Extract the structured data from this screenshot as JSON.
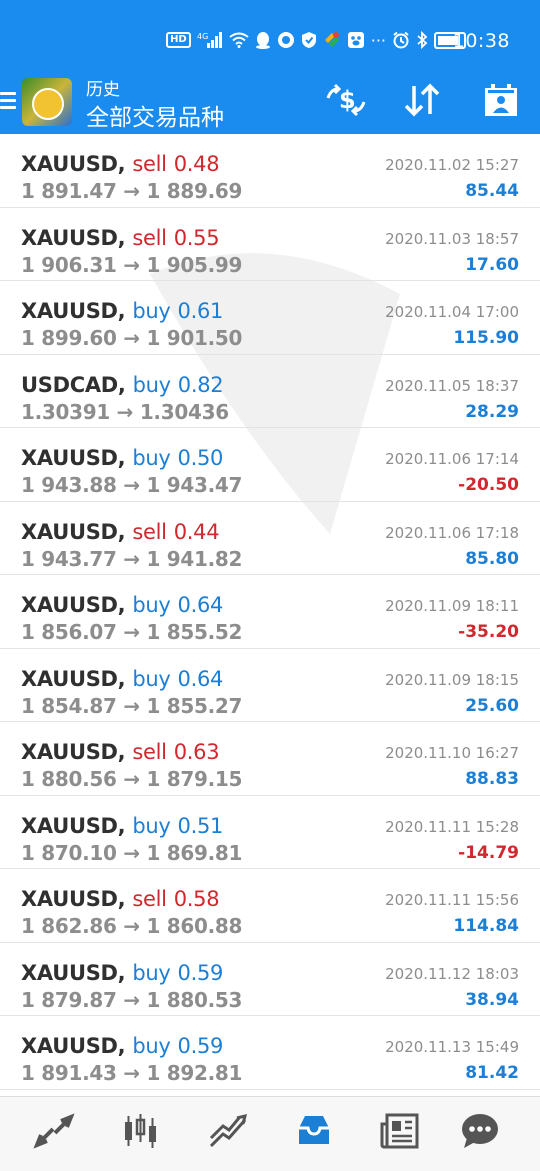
{
  "status_bar": {
    "hd": "HD",
    "network": "4G",
    "time": "10:38"
  },
  "header": {
    "subtitle": "历史",
    "title": "全部交易品种",
    "accent_color": "#1a8cf0"
  },
  "trades": [
    {
      "symbol": "XAUUSD,",
      "side": "sell",
      "volume": "0.48",
      "open": "1 891.47",
      "close": "1 889.69",
      "date": "2020.11.02 15:27",
      "profit": "85.44"
    },
    {
      "symbol": "XAUUSD,",
      "side": "sell",
      "volume": "0.55",
      "open": "1 906.31",
      "close": "1 905.99",
      "date": "2020.11.03 18:57",
      "profit": "17.60"
    },
    {
      "symbol": "XAUUSD,",
      "side": "buy",
      "volume": "0.61",
      "open": "1 899.60",
      "close": "1 901.50",
      "date": "2020.11.04 17:00",
      "profit": "115.90"
    },
    {
      "symbol": "USDCAD,",
      "side": "buy",
      "volume": "0.82",
      "open": "1.30391",
      "close": "1.30436",
      "date": "2020.11.05 18:37",
      "profit": "28.29"
    },
    {
      "symbol": "XAUUSD,",
      "side": "buy",
      "volume": "0.50",
      "open": "1 943.88",
      "close": "1 943.47",
      "date": "2020.11.06 17:14",
      "profit": "-20.50"
    },
    {
      "symbol": "XAUUSD,",
      "side": "sell",
      "volume": "0.44",
      "open": "1 943.77",
      "close": "1 941.82",
      "date": "2020.11.06 17:18",
      "profit": "85.80"
    },
    {
      "symbol": "XAUUSD,",
      "side": "buy",
      "volume": "0.64",
      "open": "1 856.07",
      "close": "1 855.52",
      "date": "2020.11.09 18:11",
      "profit": "-35.20"
    },
    {
      "symbol": "XAUUSD,",
      "side": "buy",
      "volume": "0.64",
      "open": "1 854.87",
      "close": "1 855.27",
      "date": "2020.11.09 18:15",
      "profit": "25.60"
    },
    {
      "symbol": "XAUUSD,",
      "side": "sell",
      "volume": "0.63",
      "open": "1 880.56",
      "close": "1 879.15",
      "date": "2020.11.10 16:27",
      "profit": "88.83"
    },
    {
      "symbol": "XAUUSD,",
      "side": "buy",
      "volume": "0.51",
      "open": "1 870.10",
      "close": "1 869.81",
      "date": "2020.11.11 15:28",
      "profit": "-14.79"
    },
    {
      "symbol": "XAUUSD,",
      "side": "sell",
      "volume": "0.58",
      "open": "1 862.86",
      "close": "1 860.88",
      "date": "2020.11.11 15:56",
      "profit": "114.84"
    },
    {
      "symbol": "XAUUSD,",
      "side": "buy",
      "volume": "0.59",
      "open": "1 879.87",
      "close": "1 880.53",
      "date": "2020.11.12 18:03",
      "profit": "38.94"
    },
    {
      "symbol": "XAUUSD,",
      "side": "buy",
      "volume": "0.59",
      "open": "1 891.43",
      "close": "1 892.81",
      "date": "2020.11.13 15:49",
      "profit": "81.42"
    }
  ],
  "arrow": "→",
  "colors": {
    "sell": "#d0282e",
    "buy": "#1c7fd6",
    "negative": "#d0282e",
    "positive": "#1c7fd6",
    "active_tab": "#1c7fd6",
    "inactive_tab": "#555555"
  },
  "bottom_nav": [
    {
      "icon": "quotes-icon",
      "active": false
    },
    {
      "icon": "chart-icon",
      "active": false
    },
    {
      "icon": "trade-icon",
      "active": false
    },
    {
      "icon": "history-icon",
      "active": true
    },
    {
      "icon": "news-icon",
      "active": false
    },
    {
      "icon": "chat-icon",
      "active": false
    }
  ]
}
